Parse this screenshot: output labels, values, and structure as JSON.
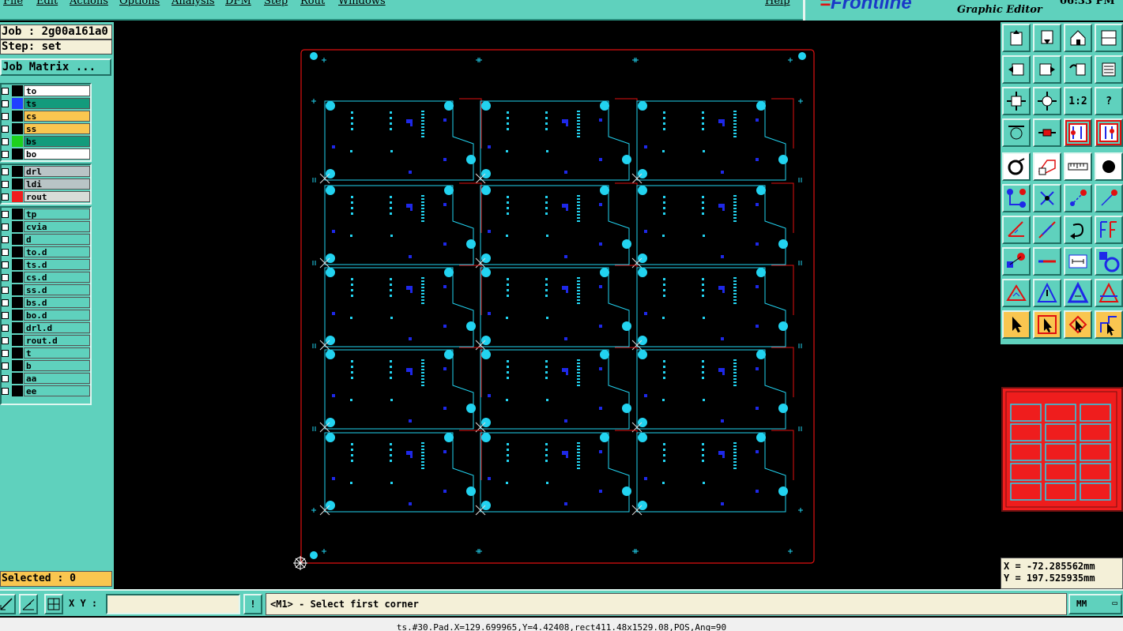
{
  "menu": [
    "File",
    "Edit",
    "Actions",
    "Options",
    "Analysis",
    "DFM",
    "Step",
    "Rout",
    "Windows"
  ],
  "help": "Help",
  "brand": {
    "logo": "Frontline",
    "subtitle": "Graphic Editor",
    "clock": "06:33 PM"
  },
  "job": {
    "job_label": "Job : 2g00a161a0",
    "step_label": "Step: set",
    "matrix_button": "Job Matrix ..."
  },
  "layers_board": [
    {
      "name": "to",
      "swatch": "#000000",
      "bg": "#ffffff"
    },
    {
      "name": "ts",
      "swatch": "#2040ff",
      "bg": "#139b7c"
    },
    {
      "name": "cs",
      "swatch": "#000000",
      "bg": "#f9c650"
    },
    {
      "name": "ss",
      "swatch": "#000000",
      "bg": "#f9c650"
    },
    {
      "name": "bs",
      "swatch": "#1ed01e",
      "bg": "#139b7c"
    },
    {
      "name": "bo",
      "swatch": "#000000",
      "bg": "#ffffff"
    }
  ],
  "layers_drill": [
    {
      "name": "drl",
      "swatch": "#000000",
      "bg": "#b9c4c6"
    },
    {
      "name": "ldi",
      "swatch": "#000000",
      "bg": "#b9c4c6"
    },
    {
      "name": "rout",
      "swatch": "#ef1d1d",
      "bg": "#d8dcd8"
    }
  ],
  "layers_misc": [
    "tp",
    "cvia",
    "d",
    "to.d",
    "ts.d",
    "cs.d",
    "ss.d",
    "bs.d",
    "bo.d",
    "drl.d",
    "rout.d",
    "t",
    "b",
    "aa",
    "ee"
  ],
  "selected": "Selected : 0",
  "coords": {
    "x": "X = -72.285562mm",
    "y": "Y =  197.525935mm"
  },
  "toolbar": {
    "ratio": "1:2",
    "help": "?"
  },
  "bottom": {
    "xy_label": "X Y :",
    "xy_value": "",
    "prompt": "<M1> - Select first corner",
    "unit": "MM",
    "warn": "!"
  },
  "status": "ts.#30.Pad.X=129.699965,Y=4.42408,rect411.48x1529.08,POS,Ang=90",
  "colors": {
    "panel": "#5fd1bd",
    "outline": "#e01010",
    "board": "#22d3f0",
    "pad": "#1e28e8"
  }
}
